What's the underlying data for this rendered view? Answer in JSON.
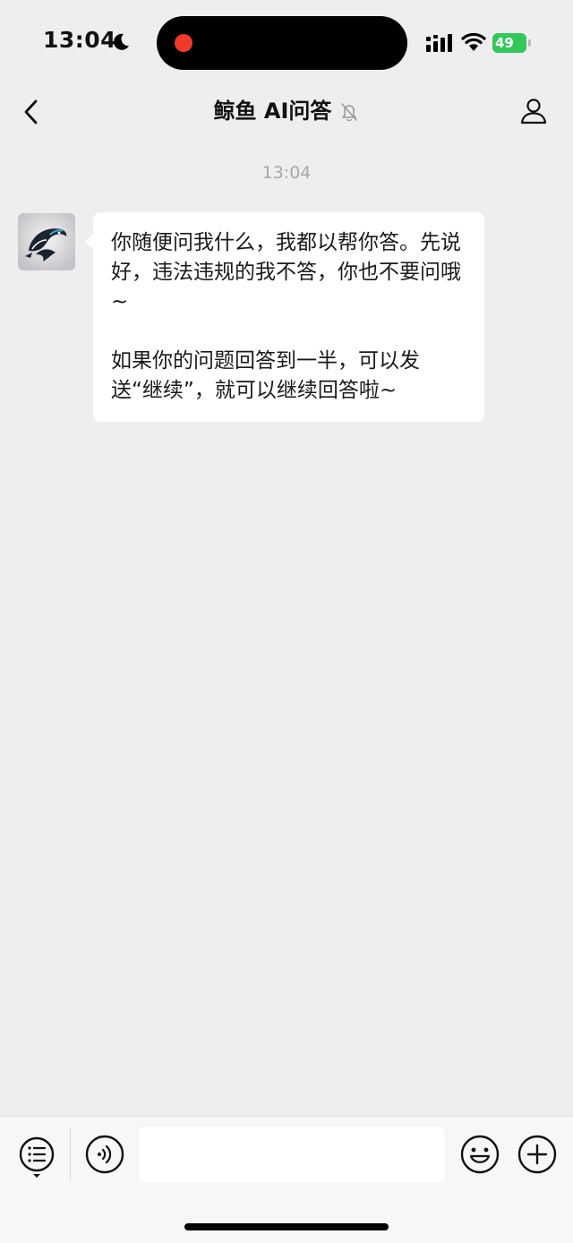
{
  "status_bar": {
    "time": "13:04",
    "battery": "49"
  },
  "nav": {
    "title": "鲸鱼 AI问答"
  },
  "chat": {
    "timestamp": "13:04",
    "messages": [
      {
        "sender": "bot",
        "text": "你随便问我什么，我都以帮你答。先说好，违法违规的我不答，你也不要问哦~\n\n如果你的问题回答到一半，可以发送“继续”，就可以继续回答啦~"
      }
    ]
  },
  "input": {
    "value": "",
    "placeholder": ""
  },
  "colors": {
    "background": "#efedf0",
    "bubble": "#ffffff",
    "recording_dot": "#f03a2c",
    "battery": "#34c759"
  }
}
